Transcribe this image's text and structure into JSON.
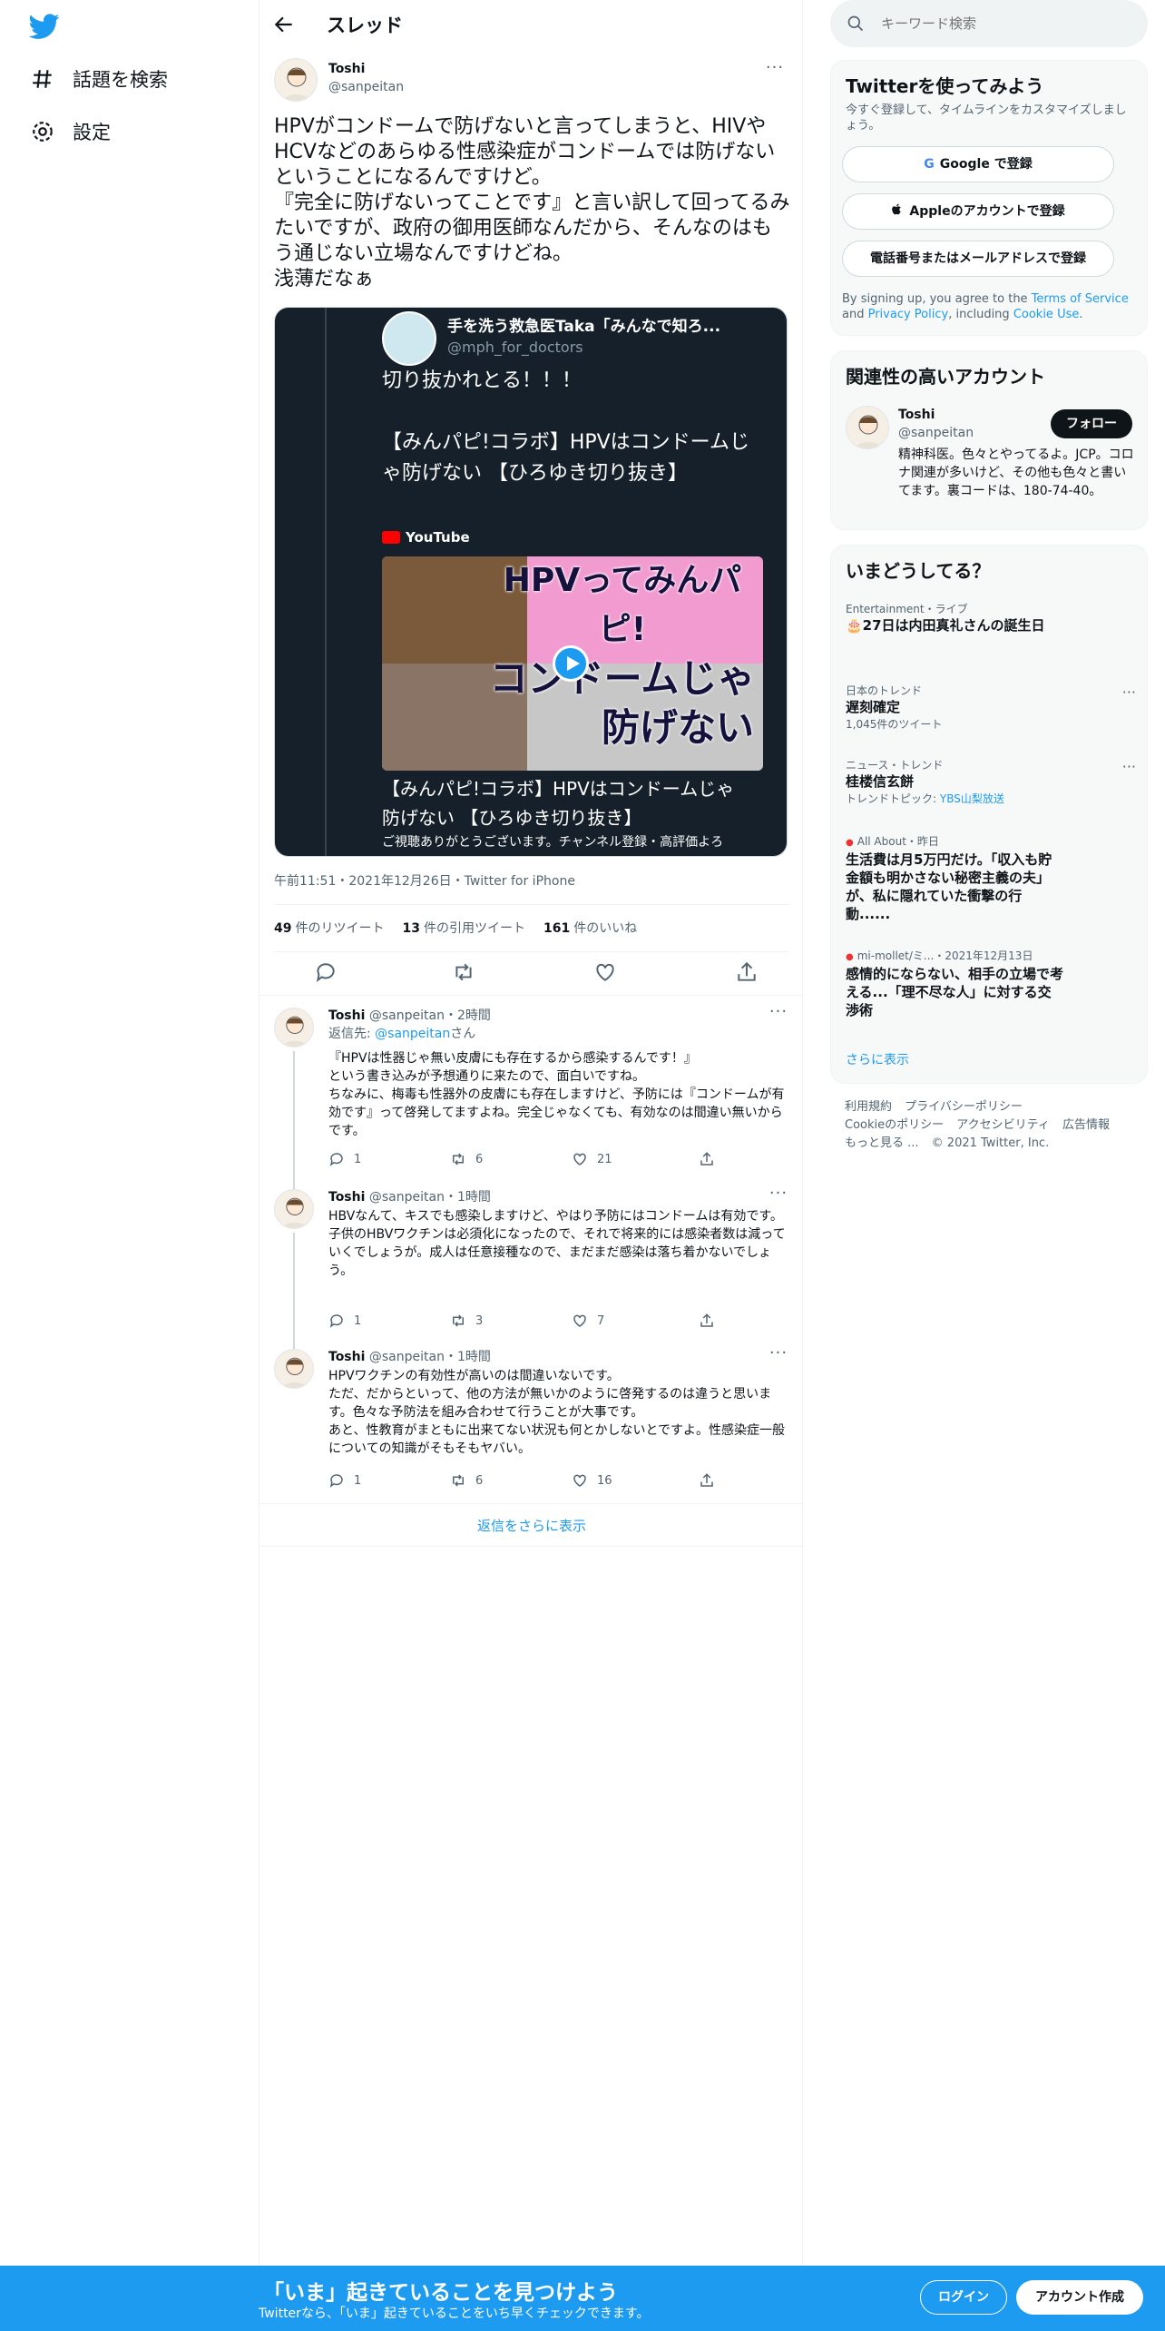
{
  "nav": {
    "explore": "話題を検索",
    "settings": "設定"
  },
  "header": {
    "title": "スレッド"
  },
  "tweet": {
    "name": "Toshi",
    "handle": "@sanpeitan",
    "text": "HPVがコンドームで防げないと言ってしまうと、HIVやHCVなどのあらゆる性感染症がコンドームでは防げないということになるんですけど。\n『完全に防げないってことです』と言い訳して回ってるみたいですが、政府の御用医師なんだから、そんなのはもう通じない立場なんですけどね。\n浅薄だなぁ",
    "media": {
      "quoted_name": "手を洗う救急医Taka「みんなで知ろ...",
      "quoted_handle": "@mph_for_doctors",
      "quoted_text": "切り抜かれとる！！！\n\n【みんパピ!コラボ】HPVはコンドームじゃ防げない 【ひろゆき切り抜き】",
      "source": "YouTube",
      "thumb_line1": "HPVってみんパピ!",
      "thumb_line2": "コンドームじゃ",
      "thumb_line3": "防げない",
      "video_title": "【みんパピ!コラボ】HPVはコンドームじゃ\n防げない 【ひろゆき切り抜き】",
      "video_desc": "ご視聴ありがとうございます。チャンネル登録・高評価よろ"
    },
    "meta": "午前11:51・2021年12月26日・Twitter for iPhone",
    "retweets_count": "49",
    "retweets_label": "件のリツイート",
    "quotes_count": "13",
    "quotes_label": "件の引用ツイート",
    "likes_count": "161",
    "likes_label": "件のいいね"
  },
  "replies": [
    {
      "name": "Toshi",
      "handle_time": "@sanpeitan・2時間",
      "reply_to_label": "返信先:",
      "reply_to_handle": "@sanpeitan",
      "reply_to_suffix": "さん",
      "text": "『HPVは性器じゃ無い皮膚にも存在するから感染するんです！』\nという書き込みが予想通りに来たので、面白いですね。\nちなみに、梅毒も性器外の皮膚にも存在しますけど、予防には『コンドームが有効です』って啓発してますよね。完全じゃなくても、有効なのは間違い無いからです。",
      "replies": "1",
      "retweets": "6",
      "likes": "21"
    },
    {
      "name": "Toshi",
      "handle_time": "@sanpeitan・1時間",
      "text": "HBVなんて、キスでも感染しますけど、やはり予防にはコンドームは有効です。\n子供のHBVワクチンは必須化になったので、それで将来的には感染者数は減っていくでしょうが。成人は任意接種なので、まだまだ感染は落ち着かないでしょう。",
      "replies": "1",
      "retweets": "3",
      "likes": "7"
    },
    {
      "name": "Toshi",
      "handle_time": "@sanpeitan・1時間",
      "text": "HPVワクチンの有効性が高いのは間違いないです。\nただ、だからといって、他の方法が無いかのように啓発するのは違うと思います。色々な予防法を組み合わせて行うことが大事です。\nあと、性教育がまともに出来てない状況も何とかしないとですよ。性感染症一般についての知識がそもそもヤバい。",
      "replies": "1",
      "retweets": "6",
      "likes": "16"
    }
  ],
  "show_more_replies": "返信をさらに表示",
  "search": {
    "placeholder": "キーワード検索"
  },
  "signup": {
    "title": "Twitterを使ってみよう",
    "subtitle": "今すぐ登録して、タイムラインをカスタマイズしましょう。",
    "google": "Google で登録",
    "apple": "Appleのアカウントで登録",
    "phone": "電話番号またはメールアドレスで登録",
    "legal_pre": "By signing up, you agree to the ",
    "tos": "Terms of Service",
    "legal_and": " and ",
    "privacy": "Privacy Policy",
    "legal_including": ", including ",
    "cookie": "Cookie Use",
    "legal_end": "."
  },
  "related": {
    "title": "関連性の高いアカウント",
    "name": "Toshi",
    "handle": "@sanpeitan",
    "follow": "フォロー",
    "bio": "精神科医。色々とやってるよ。JCP。コロナ関連が多いけど、その他も色々と書いてます。裏コードは、180-74-40。"
  },
  "trends": {
    "title": "いまどうしてる？",
    "items": [
      {
        "meta": "Entertainment・ライブ",
        "title": "🎂27日は内田真礼さんの誕生日",
        "sub": ""
      },
      {
        "meta": "日本のトレンド",
        "title": "遅刻確定",
        "sub": "1,045件のツイート"
      },
      {
        "meta": "ニュース・トレンド",
        "title": "桂楼信玄餅",
        "sub_label": "トレンドトピック:",
        "sub_link": "YBS山梨放送"
      },
      {
        "meta": "All About・昨日",
        "title": "生活費は月5万円だけ。「収入も貯金額も明かさない秘密主義の夫」が、私に隠れていた衝撃の行動......"
      },
      {
        "meta": "mi-mollet/ミ...・2021年12月13日",
        "title": "感情的にならない、相手の立場で考える...「理不尽な人」に対する交渉術"
      }
    ],
    "see_more": "さらに表示"
  },
  "footer": {
    "terms": "利用規約",
    "privacy": "プライバシーポリシー",
    "cookie": "Cookieのポリシー",
    "accessibility": "アクセシビリティ",
    "ads": "広告情報",
    "more": "もっと見る ...",
    "copyright": "© 2021 Twitter, Inc."
  },
  "banner": {
    "title": "「いま」起きていることを見つけよう",
    "subtitle": "Twitterなら、「いま」起きていることをいち早くチェックできます。",
    "login": "ログイン",
    "signup": "アカウント作成"
  },
  "colors": {
    "accent": "#1d9bf0",
    "text": "#0f1419",
    "muted": "#536471"
  }
}
